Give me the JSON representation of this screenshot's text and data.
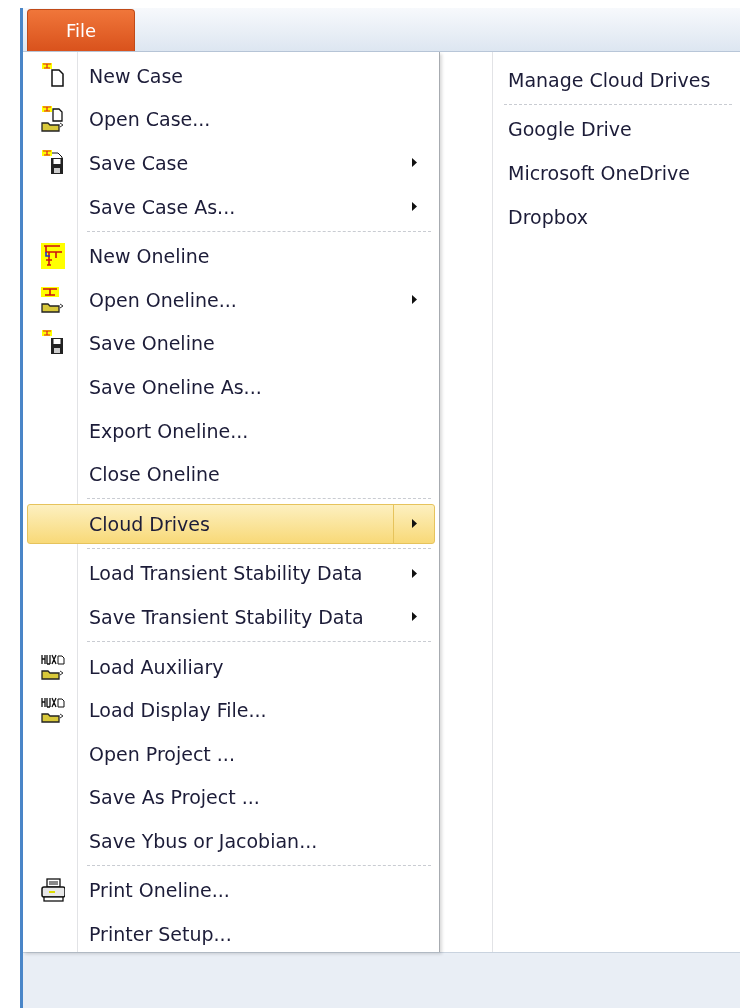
{
  "menu_bar": {
    "tabs": [
      {
        "label": "File",
        "selected": true
      }
    ]
  },
  "file_menu": {
    "items": [
      {
        "kind": "item",
        "label": "New Case",
        "submenu": false,
        "selected": false
      },
      {
        "kind": "item",
        "label": "Open Case...",
        "submenu": false,
        "selected": false
      },
      {
        "kind": "item",
        "label": "Save Case",
        "submenu": true,
        "selected": false
      },
      {
        "kind": "item",
        "label": "Save Case As...",
        "submenu": true,
        "selected": false
      },
      {
        "kind": "separator"
      },
      {
        "kind": "item",
        "label": "New Oneline",
        "submenu": false,
        "selected": false
      },
      {
        "kind": "item",
        "label": "Open Oneline...",
        "submenu": true,
        "selected": false
      },
      {
        "kind": "item",
        "label": "Save Oneline",
        "submenu": false,
        "selected": false
      },
      {
        "kind": "item",
        "label": "Save Oneline As...",
        "submenu": false,
        "selected": false
      },
      {
        "kind": "item",
        "label": "Export Oneline...",
        "submenu": false,
        "selected": false
      },
      {
        "kind": "item",
        "label": "Close Oneline",
        "submenu": false,
        "selected": false
      },
      {
        "kind": "separator"
      },
      {
        "kind": "item",
        "label": "Cloud Drives",
        "submenu": true,
        "selected": true
      },
      {
        "kind": "separator"
      },
      {
        "kind": "item",
        "label": "Load Transient Stability Data",
        "submenu": true,
        "selected": false
      },
      {
        "kind": "item",
        "label": "Save Transient Stability Data",
        "submenu": true,
        "selected": false
      },
      {
        "kind": "separator"
      },
      {
        "kind": "item",
        "label": "Load Auxiliary",
        "submenu": false,
        "selected": false
      },
      {
        "kind": "item",
        "label": "Load Display File...",
        "submenu": false,
        "selected": false
      },
      {
        "kind": "item",
        "label": "Open Project ...",
        "submenu": false,
        "selected": false
      },
      {
        "kind": "item",
        "label": "Save As Project ...",
        "submenu": false,
        "selected": false
      },
      {
        "kind": "item",
        "label": "Save Ybus or Jacobian...",
        "submenu": false,
        "selected": false
      },
      {
        "kind": "separator"
      },
      {
        "kind": "item",
        "label": "Print Oneline...",
        "submenu": false,
        "selected": false
      },
      {
        "kind": "item",
        "label": "Printer Setup...",
        "submenu": false,
        "selected": false
      }
    ]
  },
  "cloud_submenu": {
    "items": [
      {
        "kind": "item",
        "label": "Manage Cloud Drives",
        "submenu": false,
        "selected": false
      },
      {
        "kind": "separator"
      },
      {
        "kind": "item",
        "label": "Google Drive",
        "submenu": false,
        "selected": false
      },
      {
        "kind": "item",
        "label": "Microsoft OneDrive",
        "submenu": false,
        "selected": false
      },
      {
        "kind": "item",
        "label": "Dropbox",
        "submenu": false,
        "selected": false
      }
    ]
  }
}
